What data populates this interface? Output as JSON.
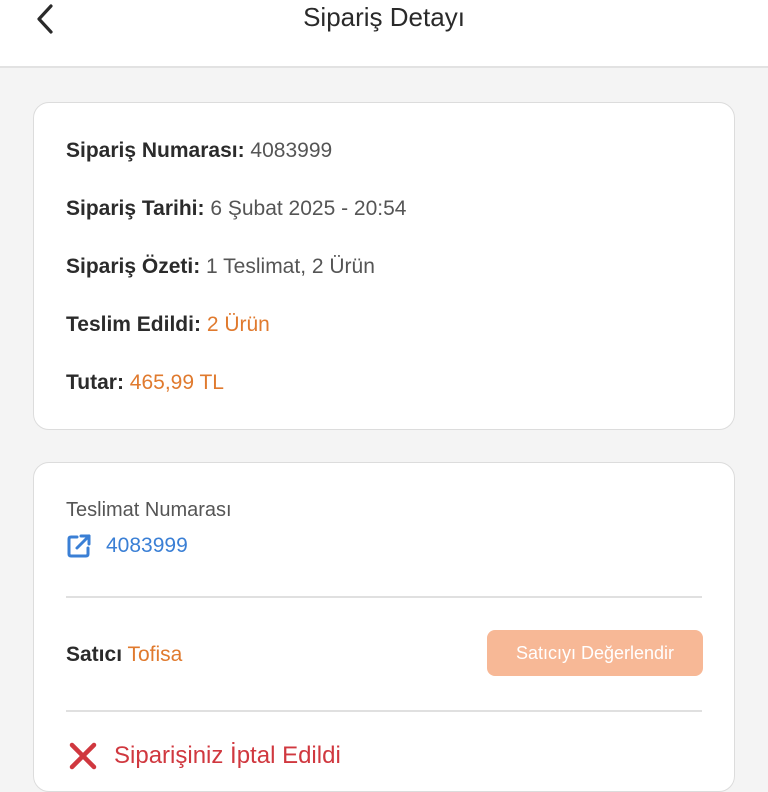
{
  "header": {
    "title": "Sipariş Detayı"
  },
  "summary": {
    "order_number_label": "Sipariş Numarası:",
    "order_number": "4083999",
    "order_date_label": "Sipariş Tarihi:",
    "order_date": "6 Şubat 2025 - 20:54",
    "order_summary_label": "Sipariş Özeti:",
    "order_summary": "1 Teslimat, 2 Ürün",
    "delivered_label": "Teslim Edildi:",
    "delivered": "2 Ürün",
    "total_label": "Tutar:",
    "total": "465,99 TL"
  },
  "delivery": {
    "label": "Teslimat Numarası",
    "number": "4083999",
    "seller_label": "Satıcı",
    "seller_name": "Tofisa",
    "rate_seller_button": "Satıcıyı Değerlendir",
    "cancel_status": "Siparişiniz İptal Edildi"
  },
  "icons": {
    "back": "chevron-left-icon",
    "external_link": "external-link-icon",
    "cancel": "close-icon"
  },
  "colors": {
    "accent": "#e07a2e",
    "link": "#3a7fd5",
    "button": "#f7b896",
    "cancel": "#d0383f"
  }
}
